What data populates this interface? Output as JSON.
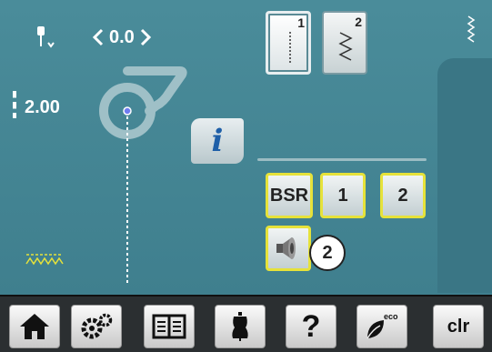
{
  "needle_position": {
    "value": "0.0"
  },
  "stitch_width": {
    "value": "2.00"
  },
  "stitch_buttons": [
    {
      "number": "1",
      "icon": "straight-stitch-icon"
    },
    {
      "number": "2",
      "icon": "zigzag-stitch-icon"
    }
  ],
  "info_button": {
    "label": "i"
  },
  "mode_buttons": {
    "bsr": "BSR",
    "one": "1",
    "two": "2"
  },
  "sound_button": {
    "icon": "speaker-icon"
  },
  "callout": {
    "label": "2"
  },
  "bottom_nav": {
    "home": "home-icon",
    "setup": "gears-icon",
    "tutorial": "book-icon",
    "creative": "dress-form-icon",
    "help_label": "?",
    "eco": "eco-icon",
    "clear_label": "clr"
  },
  "colors": {
    "screen_bg": "#3f7f8e",
    "highlight": "#e6e23a",
    "bottom_bar": "#2b2f31",
    "info_blue": "#1e5fa8"
  }
}
